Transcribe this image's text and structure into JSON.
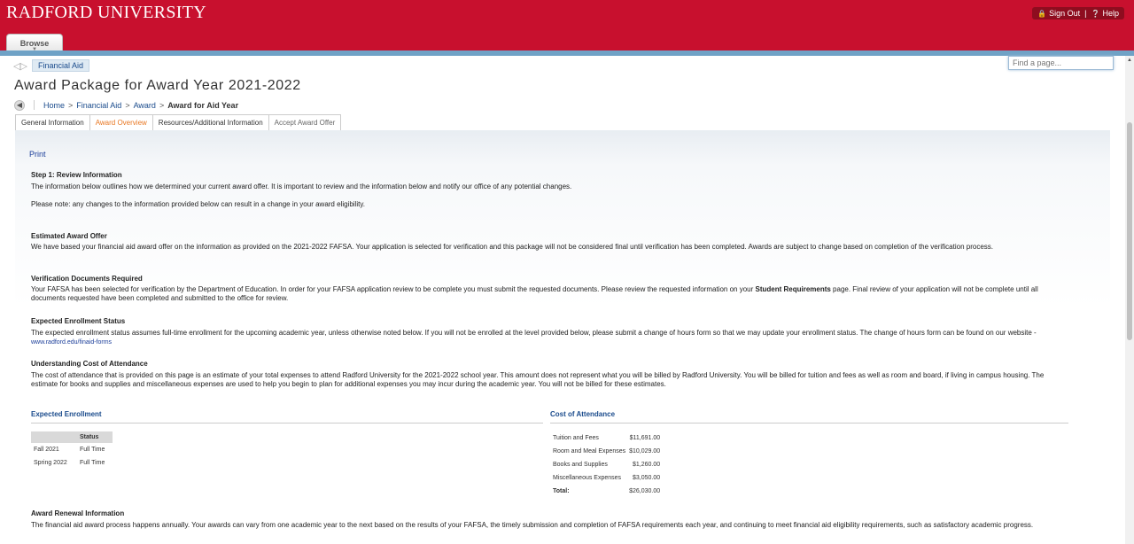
{
  "header": {
    "brand": "RADFORD UNIVERSITY",
    "sign_out": "Sign Out",
    "help": "Help",
    "browse": "Browse"
  },
  "nav": {
    "chip": "Financial Aid",
    "search_placeholder": "Find a page..."
  },
  "page": {
    "title": "Award Package for Award Year 2021-2022",
    "breadcrumb": [
      "Home",
      "Financial Aid",
      "Award",
      "Award for Aid Year"
    ]
  },
  "tabs": [
    {
      "label": "General Information"
    },
    {
      "label": "Award Overview"
    },
    {
      "label": "Resources/Additional Information"
    },
    {
      "label": "Accept Award Offer"
    }
  ],
  "content": {
    "print": "Print",
    "step1": {
      "heading": "Step 1: Review Information",
      "p1": "The information below outlines how we determined your current award offer. It is important to review and the information below and notify our office of any potential changes.",
      "p2": "Please note: any changes to the information provided below can result in a change in your award eligibility."
    },
    "estimated": {
      "heading": "Estimated Award Offer",
      "body": "We have based your financial aid award offer on the information as provided on the 2021-2022 FAFSA. Your application is selected for verification and this package will not be considered final until verification has been completed. Awards are subject to change based on completion of the verification process."
    },
    "verification": {
      "heading": "Verification Documents Required",
      "body_pre": "Your FAFSA has been selected for verification by the Department of Education. In order for your FAFSA application review to be complete you must submit the requested documents. Please review the requested information on your ",
      "body_bold": "Student Requirements",
      "body_post": " page. Final review of your application will not be complete until all documents requested have been completed and submitted to the office for review."
    },
    "enrollment_status": {
      "heading": "Expected Enrollment Status",
      "body": "The expected enrollment status assumes full-time enrollment for the upcoming academic year, unless otherwise noted below. If you will not be enrolled at the level provided below, please submit a change of hours form so that we may update your enrollment status. The change of hours form can be found on our website - ",
      "link": "www.radford.edu/finaid-forms"
    },
    "coa_info": {
      "heading": "Understanding Cost of Attendance",
      "body": "The cost of attendance that is provided on this page is an estimate of your total expenses to attend Radford University for the 2021-2022 school year. This amount does not represent what you will be billed by Radford University. You will be billed for tuition and fees as well as room and board, if living in campus housing. The estimate for books and supplies and miscellaneous expenses are used to help you begin to plan for additional expenses you may incur during the academic year. You will not be billed for these estimates."
    },
    "expected_enrollment": {
      "heading": "Expected Enrollment",
      "col_status": "Status",
      "rows": [
        {
          "term": "Fall 2021",
          "status": "Full Time"
        },
        {
          "term": "Spring 2022",
          "status": "Full Time"
        }
      ]
    },
    "cost_of_attendance": {
      "heading": "Cost of Attendance",
      "rows": [
        {
          "label": "Tuition and Fees",
          "amount": "$11,691.00"
        },
        {
          "label": "Room and Meal Expenses",
          "amount": "$10,029.00"
        },
        {
          "label": "Books and Supplies",
          "amount": "$1,260.00"
        },
        {
          "label": "Miscellaneous Expenses",
          "amount": "$3,050.00"
        }
      ],
      "total_label": "Total:",
      "total_amount": "$26,030.00"
    },
    "renewal": {
      "heading": "Award Renewal Information",
      "body": "The financial aid award process happens annually. Your awards can vary from one academic year to the next based on the results of your FAFSA, the timely submission and completion of FAFSA requirements each year, and continuing to meet financial aid eligibility requirements, such as satisfactory academic progress."
    }
  }
}
